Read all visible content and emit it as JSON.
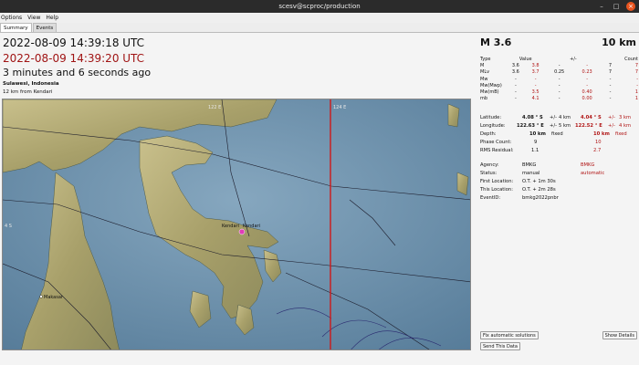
{
  "window": {
    "title": "scesv@scproc/production",
    "minimize": "–",
    "maximize": "□",
    "close": "×"
  },
  "menu": [
    "Options",
    "View",
    "Help"
  ],
  "tabs": [
    "Summary",
    "Events"
  ],
  "event": {
    "origin_time": "2022-08-09 14:39:18 UTC",
    "creation_time": "2022-08-09 14:39:20 UTC",
    "elapsed": "3 minutes and 6 seconds ago",
    "region": "Sulawesi, Indonesia",
    "nearest": "12 km from Kendari"
  },
  "map": {
    "lon_labels": [
      "122 E",
      "124 E"
    ],
    "lat_label": "4 S",
    "city_kendari": "Kendari",
    "city_makasar": "Makasar",
    "colors": {
      "sea": "#6f92ae",
      "land": "#b8b07a",
      "line": "#d01818"
    }
  },
  "summary": {
    "magnitude": "M 3.6",
    "depth": "10 km",
    "mag_table": {
      "headers": [
        "Type",
        "Value",
        "",
        "+/-",
        "",
        "Count"
      ],
      "rows": [
        [
          "M",
          "3.6",
          "3.8",
          "-",
          "-",
          "7",
          "7"
        ],
        [
          "MLv",
          "3.6",
          "3.7",
          "0.25",
          "0.23",
          "7",
          "7"
        ],
        [
          "Mw",
          "-",
          "-",
          "-",
          "-",
          "-",
          "-"
        ],
        [
          "Mw(Mwp)",
          "-",
          "-",
          "-",
          "-",
          "-",
          "-"
        ],
        [
          "Mw(mB)",
          "-",
          "3.5",
          "-",
          "0.40",
          "-",
          "1"
        ],
        [
          "mb",
          "-",
          "4.1",
          "-",
          "0.00",
          "-",
          "1"
        ]
      ]
    },
    "info": {
      "latitude": {
        "label": "Latitude:",
        "v1": "4.08 ° S",
        "pm1": "+/-",
        "u1": "4 km",
        "v2": "4.04 ° S",
        "pm2": "+/-",
        "u2": "3 km"
      },
      "longitude": {
        "label": "Longitude:",
        "v1": "122.63 ° E",
        "pm1": "+/-",
        "u1": "5 km",
        "v2": "122.52 ° E",
        "pm2": "+/-",
        "u2": "4 km"
      },
      "depth": {
        "label": "Depth:",
        "v1": "10 km",
        "f1": "fixed",
        "v2": "10 km",
        "f2": "fixed"
      },
      "phase": {
        "label": "Phase Count:",
        "v1": "9",
        "v2": "10"
      },
      "rms": {
        "label": "RMS Residual:",
        "v1": "1.1",
        "v2": "2.7"
      },
      "agency": {
        "label": "Agency:",
        "v1": "BMKG",
        "v2": "BMKG"
      },
      "status": {
        "label": "Status:",
        "v1": "manual",
        "v2": "automatic"
      },
      "first_loc": {
        "label": "First Location:",
        "v1": "O.T. + 1m 30s"
      },
      "this_loc": {
        "label": "This Location:",
        "v1": "O.T. + 2m 28s"
      },
      "event_id": {
        "label": "EventID:",
        "v1": "bmkg2022pnbr"
      }
    },
    "buttons": {
      "fix": "Fix automatic solutions",
      "show": "Show Details",
      "send": "Send This Data"
    }
  }
}
